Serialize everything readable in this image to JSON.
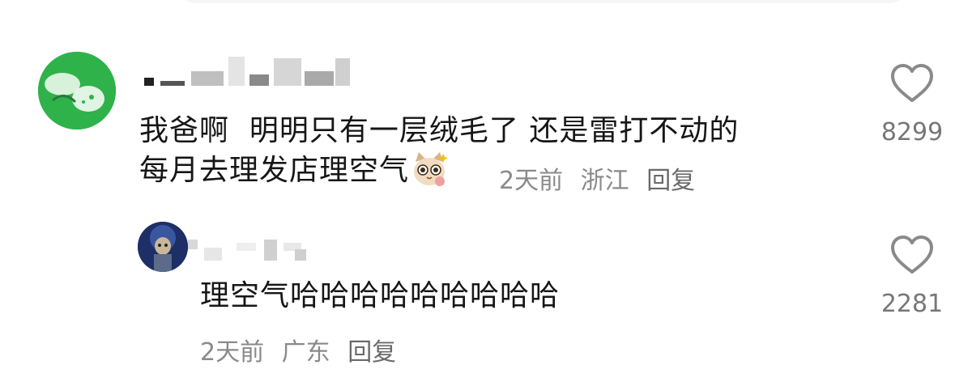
{
  "comment": {
    "text_line1": "我爸啊  明明只有一层绒毛了 还是雷打不动的",
    "text_line2": "每月去理发店理空气",
    "emoji_icon": "cat-emoji-icon",
    "time": "2天前",
    "location": "浙江",
    "reply_label": "回复",
    "like_count": "8299"
  },
  "reply": {
    "text": "理空气哈哈哈哈哈哈哈哈哈",
    "time": "2天前",
    "location": "广东",
    "reply_label": "回复",
    "like_count": "2281"
  },
  "colors": {
    "avatar_green": "#2fb24a",
    "avatar_blue": "#1d2f66",
    "text": "#161616",
    "meta": "#8a8a8a"
  }
}
